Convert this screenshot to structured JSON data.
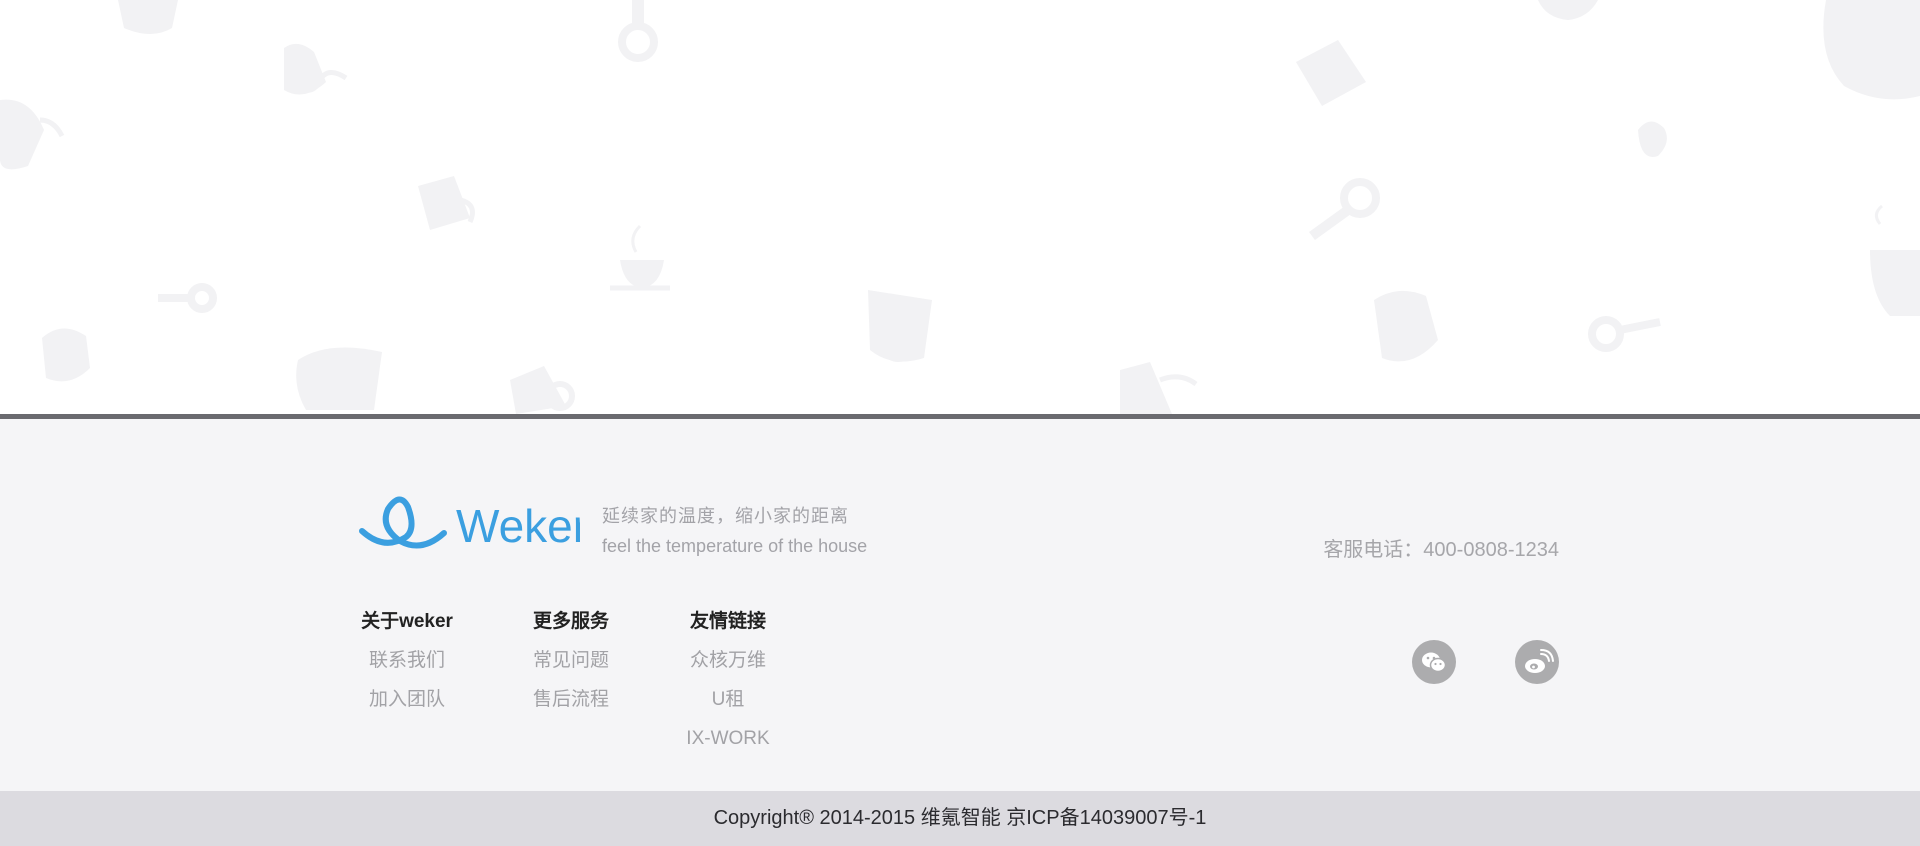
{
  "brand": {
    "logo_text": "Weker",
    "slogan_cn": "延续家的温度，缩小家的距离",
    "slogan_en": "feel the temperature of the house"
  },
  "contact": {
    "hotline": "客服电话：400-0808-1234"
  },
  "footer_columns": [
    {
      "title": "关于weker",
      "links": [
        "联系我们",
        "加入团队"
      ]
    },
    {
      "title": "更多服务",
      "links": [
        "常见问题",
        "售后流程"
      ]
    },
    {
      "title": "友情链接",
      "links": [
        "众核万维",
        "U租",
        "IX-WORK"
      ]
    }
  ],
  "social": [
    {
      "icon": "wechat-icon"
    },
    {
      "icon": "weibo-icon"
    }
  ],
  "copyright": "Copyright® 2014-2015 维氪智能 京ICP备14039007号-1",
  "colors": {
    "brand_blue": "#3b9fe0",
    "divider": "#6a6a6f",
    "footer_bg": "#f5f5f7",
    "copyright_bg": "#dcdbe0",
    "muted_text": "#a3a3a8"
  }
}
